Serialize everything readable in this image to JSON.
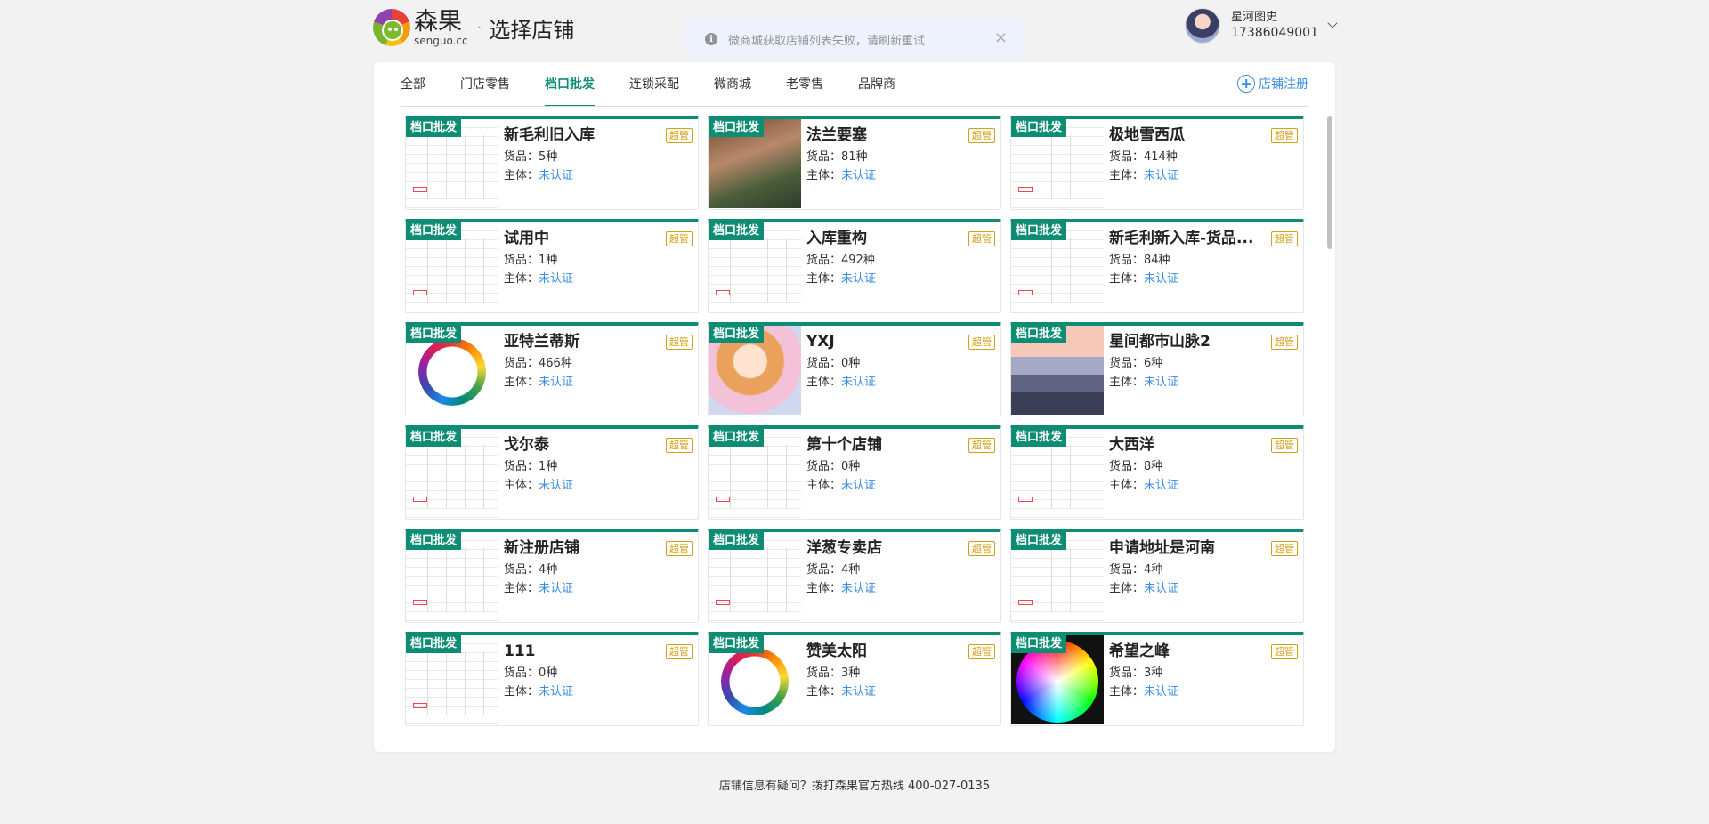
{
  "app": {
    "logo_cn": "森果",
    "logo_en": "senguo.cc",
    "separator": "·",
    "page_title": "选择店铺"
  },
  "toast": {
    "message": "微商城获取店铺列表失败，请刷新重试",
    "close": "×"
  },
  "user": {
    "name": "星河图史",
    "phone": "17386049001"
  },
  "tabs": [
    {
      "label": "全部"
    },
    {
      "label": "门店零售"
    },
    {
      "label": "档口批发",
      "active": true
    },
    {
      "label": "连锁采配"
    },
    {
      "label": "微商城"
    },
    {
      "label": "老零售"
    },
    {
      "label": "品牌商"
    }
  ],
  "register_label": "店铺注册",
  "labels": {
    "goods": "货品：",
    "entity": "主体：",
    "tag": "档口批发",
    "badge": "超管",
    "status": "未认证"
  },
  "stores": [
    {
      "name": "新毛利旧入库",
      "goods": "5种",
      "thumb": "th-doc"
    },
    {
      "name": "法兰要塞",
      "goods": "81种",
      "thumb": "th-forest"
    },
    {
      "name": "极地雪西瓜",
      "goods": "414种",
      "thumb": "th-doc"
    },
    {
      "name": "试用中",
      "goods": "1种",
      "thumb": "th-doc"
    },
    {
      "name": "入库重构",
      "goods": "492种",
      "thumb": "th-doc"
    },
    {
      "name": "新毛利新入库-货品...",
      "goods": "84种",
      "thumb": "th-doc"
    },
    {
      "name": "亚特兰蒂斯",
      "goods": "466种",
      "thumb": "th-wheel"
    },
    {
      "name": "YXJ",
      "goods": "0种",
      "thumb": "th-anime"
    },
    {
      "name": "星间都市山脉2",
      "goods": "6种",
      "thumb": "th-mountain"
    },
    {
      "name": "戈尔泰",
      "goods": "1种",
      "thumb": "th-doc"
    },
    {
      "name": "第十个店铺",
      "goods": "0种",
      "thumb": "th-doc"
    },
    {
      "name": "大西洋",
      "goods": "8种",
      "thumb": "th-doc"
    },
    {
      "name": "新注册店铺",
      "goods": "4种",
      "thumb": "th-doc"
    },
    {
      "name": "洋葱专卖店",
      "goods": "4种",
      "thumb": "th-doc"
    },
    {
      "name": "申请地址是河南",
      "goods": "4种",
      "thumb": "th-doc"
    },
    {
      "name": "111",
      "goods": "0种",
      "thumb": "th-doc"
    },
    {
      "name": "赞美太阳",
      "goods": "3种",
      "thumb": "th-wheel"
    },
    {
      "name": "希望之峰",
      "goods": "3种",
      "thumb": "th-colorwheel"
    }
  ],
  "footer": "店铺信息有疑问？拨打森果官方热线 400-027-0135",
  "colors": {
    "brand_green": "#0f8d74",
    "link_blue": "#3a8ee6",
    "badge_gold": "#d4a017"
  }
}
